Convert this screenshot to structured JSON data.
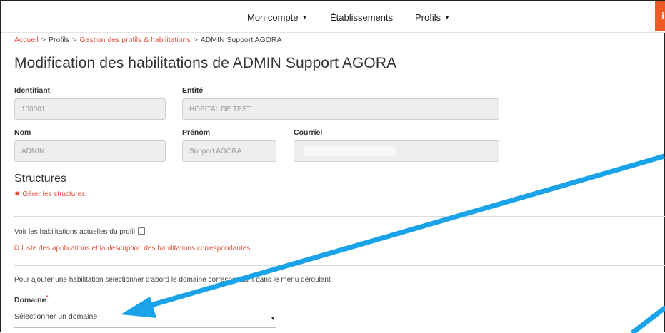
{
  "nav": {
    "mon_compte": "Mon compte",
    "etablissements": "Établissements",
    "profils": "Profils",
    "info_label": "i"
  },
  "breadcrumb": {
    "accueil": "Accueil",
    "profils": "Profils",
    "gestion": "Gestion des profils & habilitations",
    "current": "ADMIN Support AGORA",
    "separator": ">"
  },
  "page_title": "Modification des habilitations de ADMIN Support AGORA",
  "form": {
    "identifiant": {
      "label": "Identifiant",
      "value": "100001"
    },
    "entite": {
      "label": "Entité",
      "value": "HOPITAL DE TEST"
    },
    "nom": {
      "label": "Nom",
      "value": "ADMIN"
    },
    "prenom": {
      "label": "Prénom",
      "value": "Support AGORA"
    },
    "courriel": {
      "label": "Courriel",
      "value": ""
    }
  },
  "structures": {
    "title": "Structures",
    "manage_link": "Gérer les structures"
  },
  "habilitations": {
    "checkbox_label": "Voir les habilitations actuelles du profil",
    "apps_link": "Liste des applications et la description des habilitations correspondantes."
  },
  "domaine": {
    "instruction": "Pour ajouter une habilitation sélectionner d'abord le domaine correspondant dans le menu déroulant",
    "label": "Domaine",
    "required_mark": "*",
    "select_value": "Sélectionner un domaine"
  },
  "colors": {
    "accent": "#e1523d",
    "info_button": "#ee5a24",
    "annotation_arrow": "#1aa3e8"
  },
  "icons": {
    "caret": "▼",
    "gear": "✹",
    "external_link": "⧉"
  }
}
